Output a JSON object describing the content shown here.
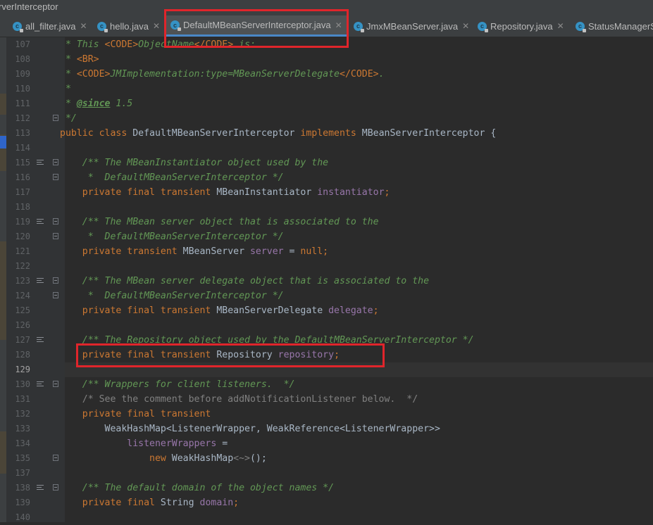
{
  "window": {
    "title": "rverInterceptor"
  },
  "tabs": [
    {
      "label": "all_filter.java",
      "active": false
    },
    {
      "label": "hello.java",
      "active": false
    },
    {
      "label": "DefaultMBeanServerInterceptor.java",
      "active": true
    },
    {
      "label": "JmxMBeanServer.java",
      "active": false
    },
    {
      "label": "Repository.java",
      "active": false
    },
    {
      "label": "StatusManagerS",
      "active": false
    }
  ],
  "lines": [
    {
      "n": "107",
      "parts": [
        [
          "cmt",
          " * This "
        ],
        [
          "tag",
          "<CODE>"
        ],
        [
          "cmt",
          "ObjectName"
        ],
        [
          "tag",
          "</CODE>"
        ],
        [
          "cmt",
          " is:"
        ]
      ]
    },
    {
      "n": "108",
      "parts": [
        [
          "cmt",
          " * "
        ],
        [
          "tag",
          "<BR>"
        ]
      ]
    },
    {
      "n": "109",
      "parts": [
        [
          "cmt",
          " * "
        ],
        [
          "tag",
          "<CODE>"
        ],
        [
          "cmt",
          "JMImplementation:type=MBeanServerDelegate"
        ],
        [
          "tag",
          "</CODE>"
        ],
        [
          "cmt",
          "."
        ]
      ]
    },
    {
      "n": "110",
      "parts": [
        [
          "cmt",
          " *"
        ]
      ]
    },
    {
      "n": "111",
      "parts": [
        [
          "cmt",
          " * "
        ],
        [
          "annot",
          "@since"
        ],
        [
          "cmt",
          " 1.5"
        ]
      ]
    },
    {
      "n": "112",
      "parts": [
        [
          "cmt",
          " */"
        ]
      ]
    },
    {
      "n": "113",
      "parts": [
        [
          "kw",
          "public class "
        ],
        [
          "id",
          "DefaultMBeanServerInterceptor "
        ],
        [
          "kw",
          "implements "
        ],
        [
          "id",
          "MBeanServerInterceptor {"
        ]
      ]
    },
    {
      "n": "114",
      "parts": []
    },
    {
      "n": "115",
      "parts": [
        [
          "cmt",
          "    /** The MBeanInstantiator object used by the"
        ]
      ]
    },
    {
      "n": "116",
      "parts": [
        [
          "cmt",
          "     *  DefaultMBeanServerInterceptor */"
        ]
      ]
    },
    {
      "n": "117",
      "parts": [
        [
          "kw",
          "    private final transient "
        ],
        [
          "id",
          "MBeanInstantiator "
        ],
        [
          "field",
          "instantiator"
        ],
        [
          "kw",
          ";"
        ]
      ]
    },
    {
      "n": "118",
      "parts": []
    },
    {
      "n": "119",
      "parts": [
        [
          "cmt",
          "    /** The MBean server object that is associated to the"
        ]
      ]
    },
    {
      "n": "120",
      "parts": [
        [
          "cmt",
          "     *  DefaultMBeanServerInterceptor */"
        ]
      ]
    },
    {
      "n": "121",
      "parts": [
        [
          "kw",
          "    private transient "
        ],
        [
          "id",
          "MBeanServer "
        ],
        [
          "field",
          "server"
        ],
        [
          "id",
          " = "
        ],
        [
          "kw",
          "null;"
        ]
      ]
    },
    {
      "n": "122",
      "parts": []
    },
    {
      "n": "123",
      "parts": [
        [
          "cmt",
          "    /** The MBean server delegate object that is associated to the"
        ]
      ]
    },
    {
      "n": "124",
      "parts": [
        [
          "cmt",
          "     *  DefaultMBeanServerInterceptor */"
        ]
      ]
    },
    {
      "n": "125",
      "parts": [
        [
          "kw",
          "    private final transient "
        ],
        [
          "id",
          "MBeanServerDelegate "
        ],
        [
          "field",
          "delegate"
        ],
        [
          "kw",
          ";"
        ]
      ]
    },
    {
      "n": "126",
      "parts": []
    },
    {
      "n": "127",
      "parts": [
        [
          "cmt",
          "    /** The Repository object used by the DefaultMBeanServerInterceptor */"
        ]
      ]
    },
    {
      "n": "128",
      "parts": [
        [
          "kw",
          "    private final transient "
        ],
        [
          "id",
          "Repository "
        ],
        [
          "field",
          "repository"
        ],
        [
          "kw",
          ";"
        ]
      ]
    },
    {
      "n": "129",
      "parts": []
    },
    {
      "n": "130",
      "parts": [
        [
          "cmt",
          "    /** Wrappers for client listeners.  */"
        ]
      ]
    },
    {
      "n": "131",
      "parts": [
        [
          "blk",
          "    /* See the comment before addNotificationListener below.  */"
        ]
      ]
    },
    {
      "n": "132",
      "parts": [
        [
          "kw",
          "    private final transient"
        ]
      ]
    },
    {
      "n": "133",
      "parts": [
        [
          "id",
          "        WeakHashMap<ListenerWrapper, WeakReference<ListenerWrapper>>"
        ]
      ]
    },
    {
      "n": "134",
      "parts": [
        [
          "field",
          "            listenerWrappers"
        ],
        [
          "id",
          " ="
        ]
      ]
    },
    {
      "n": "135",
      "parts": [
        [
          "kw",
          "                new "
        ],
        [
          "id",
          "WeakHashMap"
        ],
        [
          "blk",
          "<~>"
        ],
        [
          "id",
          "();"
        ]
      ]
    },
    {
      "n": "137",
      "parts": []
    },
    {
      "n": "138",
      "parts": [
        [
          "cmt",
          "    /** The default domain of the object names */"
        ]
      ]
    },
    {
      "n": "139",
      "parts": [
        [
          "kw",
          "    private final "
        ],
        [
          "id",
          "String "
        ],
        [
          "field",
          "domain"
        ],
        [
          "kw",
          ";"
        ]
      ]
    },
    {
      "n": "140",
      "parts": []
    }
  ]
}
